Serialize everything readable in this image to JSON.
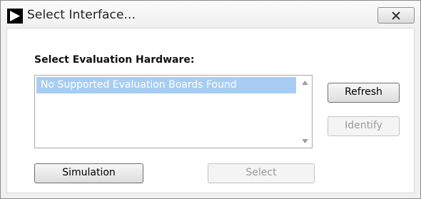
{
  "window": {
    "title": "Select Interface...",
    "close_label": "close"
  },
  "main": {
    "section_label": "Select Evaluation Hardware:",
    "list": {
      "items": [
        "No Supported Evaluation Boards Found"
      ],
      "selected_index": 0
    }
  },
  "buttons": {
    "refresh": "Refresh",
    "identify": "Identify",
    "simulation": "Simulation",
    "select": "Select"
  },
  "icons": {
    "app": "play-arrow-icon",
    "close": "close-icon",
    "scroll_up": "scroll-up-arrow-icon",
    "scroll_down": "scroll-down-arrow-icon"
  },
  "colors": {
    "selection": "#a8cdf2",
    "disabled_text": "#9a9a9a"
  }
}
